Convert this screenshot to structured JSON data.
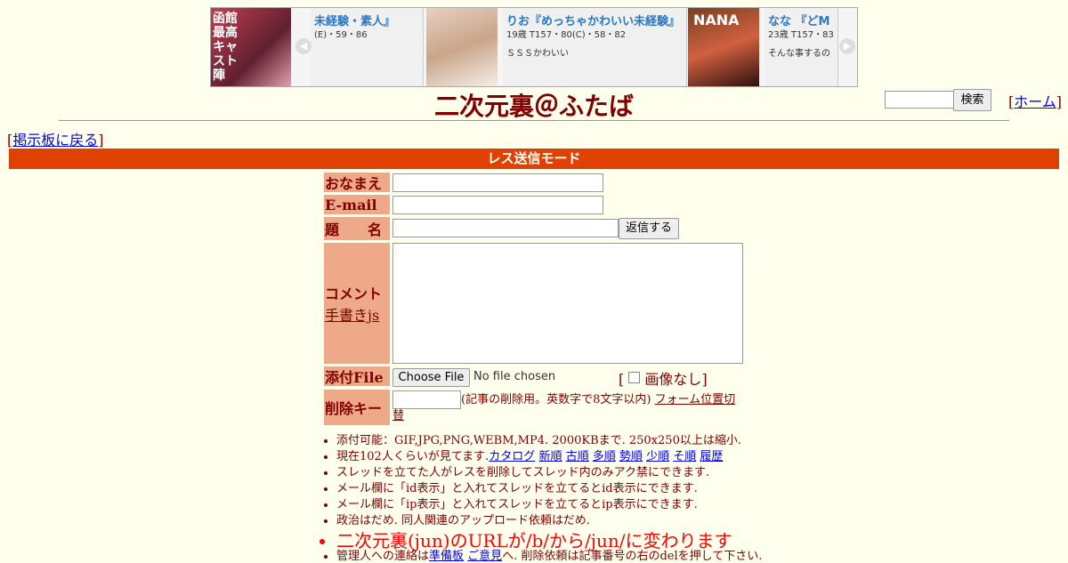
{
  "banner": {
    "prev_icon": "chevron-left-icon",
    "next_icon": "chevron-right-icon",
    "left_thumb_text": "函館最高キャスト陣",
    "cards": [
      {
        "title": "未経験・素人』",
        "stats": "(E)・59・86",
        "desc": ""
      },
      {
        "title": "りお『めっちゃかわいい未経験』",
        "stats": "19歳 T157・80(C)・58・82",
        "desc": "ＳＳＳかわいい"
      },
      {
        "title": "なな 『どM",
        "stats": "23歳 T157・83",
        "desc": "そんな事するの"
      }
    ],
    "nana_label": "NANA"
  },
  "header": {
    "title": "二次元裏＠ふたば",
    "search_button": "検索",
    "home_link": "ホーム",
    "back_link": "掲示板に戻る"
  },
  "mode_bar": "レス送信モード",
  "form": {
    "name_label": "おなまえ",
    "email_label": "E-mail",
    "subject_label": "題　　名",
    "submit_button": "返信する",
    "comment_label": "コメント",
    "handwrite_link": "手書きjs",
    "file_label": "添付File",
    "file_button": "Choose File",
    "file_status": "No file chosen",
    "no_image_label": "画像なし",
    "delkey_label": "削除キー",
    "delkey_note": "(記事の削除用。英数字で8文字以内)",
    "form_toggle_link": "フォーム位置切替"
  },
  "rules": {
    "r1": "添付可能：GIF,JPG,PNG,WEBM,MP4. 2000KBまで. 250x250以上は縮小.",
    "r2_prefix": "現在102人くらいが見てます.",
    "r2_links": [
      "カタログ",
      "新順",
      "古順",
      "多順",
      "勢順",
      "少順",
      "そ順",
      "履歴"
    ],
    "r3": "スレッドを立てた人がレスを削除してスレッド内のみアク禁にできます.",
    "r4": "メール欄に「id表示」と入れてスレッドを立てるとid表示にできます.",
    "r5": "メール欄に「ip表示」と入れてスレッドを立てるとip表示にできます.",
    "r6": "政治はだめ. 同人関連のアップロード依頼はだめ.",
    "r7": "二次元裏(jun)のURLが/b/から/jun/に変わります",
    "r8_prefix": "管理人への連絡は",
    "r8_link1": "準備板",
    "r8_link2": "ご意見",
    "r8_suffix": "へ. 削除依頼は記事番号の右のdelを押して下さい."
  },
  "colors": {
    "accent": "#e04000",
    "label_bg": "#eeaa88",
    "text": "#800000",
    "bg": "#ffffee"
  }
}
